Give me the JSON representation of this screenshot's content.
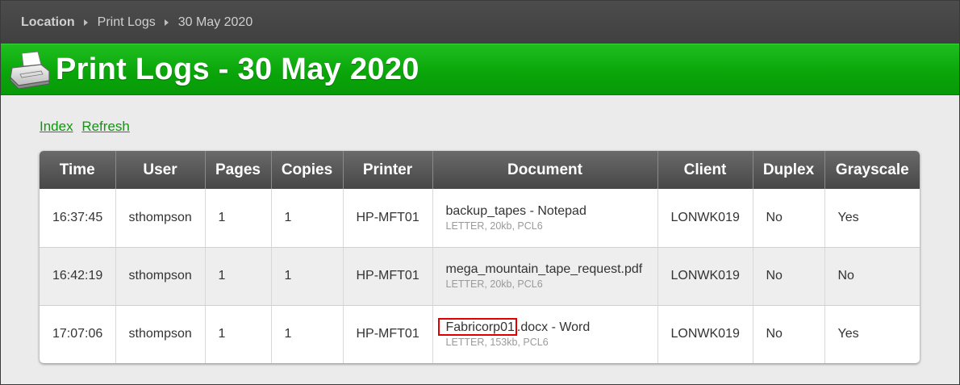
{
  "breadcrumb": {
    "root": "Location",
    "items": [
      "Print Logs",
      "30 May 2020"
    ]
  },
  "header": {
    "title": "Print Logs - 30 May 2020",
    "icon": "printer-icon"
  },
  "links": {
    "index": "Index",
    "refresh": "Refresh"
  },
  "table": {
    "columns": [
      "Time",
      "User",
      "Pages",
      "Copies",
      "Printer",
      "Document",
      "Client",
      "Duplex",
      "Grayscale"
    ],
    "rows": [
      {
        "time": "16:37:45",
        "user": "sthompson",
        "pages": "1",
        "copies": "1",
        "printer": "HP-MFT01",
        "doc_title": "backup_tapes - Notepad",
        "doc_meta": "LETTER, 20kb, PCL6",
        "client": "LONWK019",
        "duplex": "No",
        "grayscale": "Yes"
      },
      {
        "time": "16:42:19",
        "user": "sthompson",
        "pages": "1",
        "copies": "1",
        "printer": "HP-MFT01",
        "doc_title": "mega_mountain_tape_request.pdf",
        "doc_meta": "LETTER, 20kb, PCL6",
        "client": "LONWK019",
        "duplex": "No",
        "grayscale": "No"
      },
      {
        "time": "17:07:06",
        "user": "sthompson",
        "pages": "1",
        "copies": "1",
        "printer": "HP-MFT01",
        "doc_title_highlight": "Fabricorp01",
        "doc_title_rest": ".docx - Word",
        "doc_meta": "LETTER, 153kb, PCL6",
        "client": "LONWK019",
        "duplex": "No",
        "grayscale": "Yes"
      }
    ]
  },
  "colors": {
    "header_green": "#0aa60a",
    "link_green": "#0a9a0a",
    "highlight_box": "#e00000"
  }
}
